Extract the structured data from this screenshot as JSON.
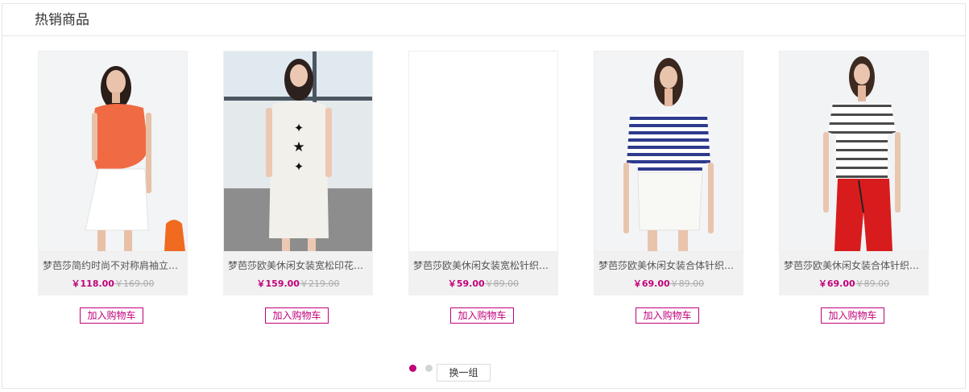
{
  "section": {
    "title": "热销商品"
  },
  "products": [
    {
      "name": "梦芭莎简约时尚不对称肩袖立领上衣",
      "price": "￥118.00",
      "old_price": "￥169.00",
      "cart_label": "加入购物车"
    },
    {
      "name": "梦芭莎欧美休闲女装宽松印花连衣裙",
      "price": "￥159.00",
      "old_price": "￥219.00",
      "cart_label": "加入购物车"
    },
    {
      "name": "梦芭莎欧美休闲女装宽松针织上衣",
      "price": "￥59.00",
      "old_price": "￥89.00",
      "cart_label": "加入购物车"
    },
    {
      "name": "梦芭莎欧美休闲女装合体针织条纹衫",
      "price": "￥69.00",
      "old_price": "￥89.00",
      "cart_label": "加入购物车"
    },
    {
      "name": "梦芭莎欧美休闲女装合体针织条纹衫",
      "price": "￥69.00",
      "old_price": "￥89.00",
      "cart_label": "加入购物车"
    }
  ],
  "pagination": {
    "swap_label": "换一组"
  },
  "colors": {
    "accent": "#c0007a",
    "price_old": "#aaaaaa",
    "info_bg": "#f1f1f1"
  }
}
